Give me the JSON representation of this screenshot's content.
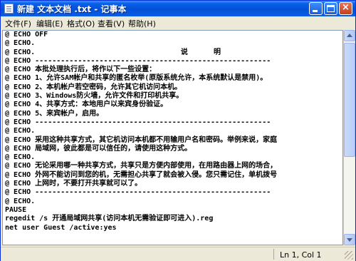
{
  "titlebar": {
    "title": "新建 文本文档 .txt - 记事本",
    "close_glyph": "×"
  },
  "menu": [
    {
      "label": "文件(F)"
    },
    {
      "label": "编辑(E)"
    },
    {
      "label": "格式(O)"
    },
    {
      "label": "查看(V)"
    },
    {
      "label": "帮助(H)"
    }
  ],
  "editor": {
    "lines": [
      "@ ECHO OFF",
      "@ ECHO.",
      "@ ECHO.                                  说      明",
      "@ ECHO -------------------------------------------------------",
      "@ ECHO 本批处理执行后，将作以下一些设置：",
      "@ ECHO 1、允许SAM帐户和共享的匿名枚举(原版系统允许，本系统默认是禁用)。",
      "@ ECHO 2、本机帐户若空密码，允许其它机访问本机。",
      "@ ECHO 3、Windows防火墙，允许文件和打印机共享。",
      "@ ECHO 4、共享方式：本地用户以来宾身份验证。",
      "@ ECHO 5、来宾帐户，启用。",
      "@ ECHO -------------------------------------------------------",
      "@ ECHO.",
      "@ ECHO 采用这种共享方式，其它机访问本机都不用输用户名和密码。举例来说，家庭",
      "@ ECHO 局域网，彼此都是可以信任的，请使用这种方式。",
      "@ ECHO.",
      "@ ECHO 无论采用哪一种共享方式，共享只是方便内部使用，在用路由器上网的场合，",
      "@ ECHO 外网不能访问到您的机，无需担心共享了就会被入侵。您只需记住，单机拨号",
      "@ ECHO 上网时，不要打开共享就可以了。",
      "@ ECHO -------------------------------------------------------",
      "@ ECHO.",
      "PAUSE",
      "regedit /s 开通局域网共享(访问本机无需验证即可进入).reg",
      "net user Guest /active:yes"
    ]
  },
  "statusbar": {
    "position": "Ln 1, Col 1"
  }
}
